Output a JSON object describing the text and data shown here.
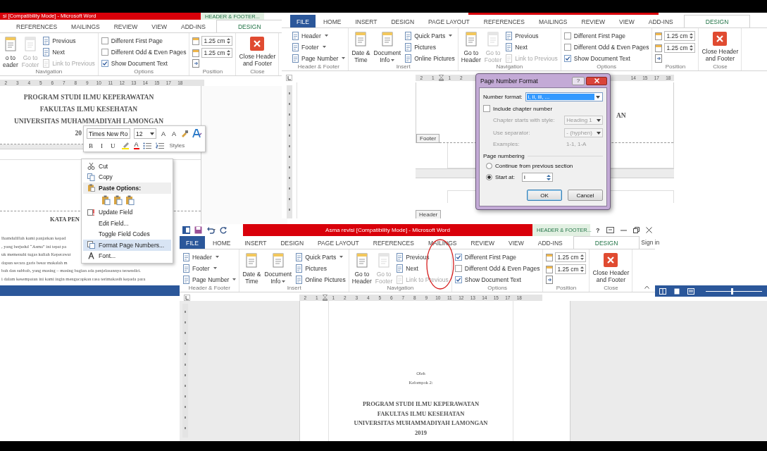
{
  "left_window": {
    "title": "si [Compatibility Mode] - Microsoft Word",
    "context_tab": "HEADER & FOOTER...",
    "tabs": [
      {
        "label": "REFERENCES",
        "kind": "normal",
        "selected": false
      },
      {
        "label": "MAILINGS",
        "kind": "normal",
        "selected": false
      },
      {
        "label": "REVIEW",
        "kind": "normal",
        "selected": false
      },
      {
        "label": "VIEW",
        "kind": "normal",
        "selected": false
      },
      {
        "label": "ADD-INS",
        "kind": "normal",
        "selected": false
      },
      {
        "label": "DESIGN",
        "kind": "contextual",
        "selected": true
      }
    ],
    "groups": [
      {
        "label": "Navigation",
        "items": [
          {
            "kind": "large",
            "label": "o to\neader",
            "disabled": false,
            "dropdown": false
          },
          {
            "kind": "large",
            "label": "Go to\nFooter",
            "disabled": true,
            "dropdown": false
          },
          {
            "kind": "small",
            "label": "Previous",
            "disabled": false,
            "dropdown": false
          },
          {
            "kind": "small",
            "label": "Next",
            "disabled": false,
            "dropdown": false
          },
          {
            "kind": "small",
            "label": "Link to Previous",
            "disabled": true,
            "dropdown": false
          }
        ]
      },
      {
        "label": "Options",
        "items": [
          {
            "kind": "check",
            "label": "Different First Page",
            "checked": false
          },
          {
            "kind": "check",
            "label": "Different Odd & Even Pages",
            "checked": false
          },
          {
            "kind": "check",
            "label": "Show Document Text",
            "checked": true
          }
        ]
      },
      {
        "label": "Position",
        "items": [
          {
            "kind": "spin",
            "value": "1.25 cm"
          },
          {
            "kind": "spin",
            "value": "1.25 cm"
          },
          {
            "kind": "icon"
          }
        ]
      },
      {
        "label": "Close",
        "items": [
          {
            "kind": "close",
            "label": "Close Header\nand Footer"
          }
        ]
      }
    ],
    "ruler": {
      "segments": [
        [
          "2",
          "3",
          "4",
          "5",
          "6",
          "7",
          "8",
          "9",
          "10",
          "11",
          "12",
          "13",
          "14",
          "15",
          "17",
          "18"
        ]
      ]
    },
    "document": {
      "title_lines": [
        "PROGRAM STUDI ILMU KEPERAWATAN",
        "FAKULTAS ILMU KESEHATAN",
        "UNIVERSITAS MUHAMMADIYAH LAMONGAN"
      ],
      "year": "20",
      "heading": "KATA PEN",
      "paragraph_lines": [
        "lhamdulillah kami panjatkan kepad",
        ", yang berjudul “Asma” ini tepat pa",
        "uk memenuhi tugas kuliah Keperawat",
        "dapun secara garis besar makalah m",
        "bah dan subbab, yang masing – masing bagian ada penjelasannya tersendiri.",
        "i dalam kesempatan ini kami ingin mengucapkan rasa terimakasih kepada para"
      ]
    }
  },
  "top_window": {
    "tabs": [
      {
        "label": "FILE",
        "kind": "file",
        "selected": false
      },
      {
        "label": "HOME",
        "kind": "normal",
        "selected": false
      },
      {
        "label": "INSERT",
        "kind": "normal",
        "selected": false
      },
      {
        "label": "DESIGN",
        "kind": "normal",
        "selected": false
      },
      {
        "label": "PAGE LAYOUT",
        "kind": "normal",
        "selected": false
      },
      {
        "label": "REFERENCES",
        "kind": "normal",
        "selected": false
      },
      {
        "label": "MAILINGS",
        "kind": "normal",
        "selected": false
      },
      {
        "label": "REVIEW",
        "kind": "normal",
        "selected": false
      },
      {
        "label": "VIEW",
        "kind": "normal",
        "selected": false
      },
      {
        "label": "ADD-INS",
        "kind": "normal",
        "selected": false
      },
      {
        "label": "DESIGN",
        "kind": "contextual",
        "selected": true
      }
    ],
    "groups": [
      {
        "label": "Header & Footer",
        "items": [
          {
            "kind": "small",
            "label": "Header",
            "disabled": false,
            "dropdown": true
          },
          {
            "kind": "small",
            "label": "Footer",
            "disabled": false,
            "dropdown": true
          },
          {
            "kind": "small",
            "label": "Page Number",
            "disabled": false,
            "dropdown": true
          }
        ]
      },
      {
        "label": "Insert",
        "items": [
          {
            "kind": "large",
            "label": "Date &\nTime",
            "disabled": false,
            "dropdown": false
          },
          {
            "kind": "large",
            "label": "Document\nInfo",
            "disabled": false,
            "dropdown": true
          },
          {
            "kind": "small",
            "label": "Quick Parts",
            "disabled": false,
            "dropdown": true
          },
          {
            "kind": "small",
            "label": "Pictures",
            "disabled": false,
            "dropdown": false
          },
          {
            "kind": "small",
            "label": "Online Pictures",
            "disabled": false,
            "dropdown": false
          }
        ]
      },
      {
        "label": "Navigation",
        "items": [
          {
            "kind": "large",
            "label": "Go to\nHeader",
            "disabled": false,
            "dropdown": false
          },
          {
            "kind": "large",
            "label": "Go to\nFooter",
            "disabled": true,
            "dropdown": false
          },
          {
            "kind": "small",
            "label": "Previous",
            "disabled": false,
            "dropdown": false
          },
          {
            "kind": "small",
            "label": "Next",
            "disabled": false,
            "dropdown": false
          },
          {
            "kind": "small",
            "label": "Link to Previous",
            "disabled": true,
            "dropdown": false
          }
        ]
      },
      {
        "label": "Options",
        "items": [
          {
            "kind": "check",
            "label": "Different First Page",
            "checked": false
          },
          {
            "kind": "check",
            "label": "Different Odd & Even Pages",
            "checked": false
          },
          {
            "kind": "check",
            "label": "Show Document Text",
            "checked": true
          }
        ]
      },
      {
        "label": "Position",
        "items": [
          {
            "kind": "spin",
            "value": "1.25 cm"
          },
          {
            "kind": "spin",
            "value": "1.25 cm"
          },
          {
            "kind": "icon"
          }
        ]
      },
      {
        "label": "Close",
        "items": [
          {
            "kind": "close",
            "label": "Close Header\nand Footer"
          }
        ]
      }
    ],
    "ruler": {
      "segments": [
        [
          "2",
          "1",
          "1",
          "2"
        ],
        [
          "14",
          "15",
          "17",
          "18"
        ]
      ],
      "indent_marker": true
    },
    "document": {
      "fragment": "AN",
      "footer_tag": "Footer",
      "header_tag": "Header"
    }
  },
  "bottom_window": {
    "title": "Asma revisi [Compatibility Mode] - Microsoft Word",
    "context_tab": "HEADER & FOOTER...",
    "help": "?",
    "sign_in": "Sign in",
    "tabs": [
      {
        "label": "FILE",
        "kind": "file",
        "selected": false
      },
      {
        "label": "HOME",
        "kind": "normal",
        "selected": false
      },
      {
        "label": "INSERT",
        "kind": "normal",
        "selected": false
      },
      {
        "label": "DESIGN",
        "kind": "normal",
        "selected": false
      },
      {
        "label": "PAGE LAYOUT",
        "kind": "normal",
        "selected": false
      },
      {
        "label": "REFERENCES",
        "kind": "normal",
        "selected": false
      },
      {
        "label": "MAILINGS",
        "kind": "normal",
        "selected": false
      },
      {
        "label": "REVIEW",
        "kind": "normal",
        "selected": false
      },
      {
        "label": "VIEW",
        "kind": "normal",
        "selected": false
      },
      {
        "label": "ADD-INS",
        "kind": "normal",
        "selected": false
      },
      {
        "label": "DESIGN",
        "kind": "contextual",
        "selected": true
      }
    ],
    "groups": [
      {
        "label": "Header & Footer",
        "items": [
          {
            "kind": "small",
            "label": "Header",
            "disabled": false,
            "dropdown": true
          },
          {
            "kind": "small",
            "label": "Footer",
            "disabled": false,
            "dropdown": true
          },
          {
            "kind": "small",
            "label": "Page Number",
            "disabled": false,
            "dropdown": true
          }
        ]
      },
      {
        "label": "Insert",
        "items": [
          {
            "kind": "large",
            "label": "Date &\nTime",
            "disabled": false,
            "dropdown": false
          },
          {
            "kind": "large",
            "label": "Document\nInfo",
            "disabled": false,
            "dropdown": true
          },
          {
            "kind": "small",
            "label": "Quick Parts",
            "disabled": false,
            "dropdown": true
          },
          {
            "kind": "small",
            "label": "Pictures",
            "disabled": false,
            "dropdown": false
          },
          {
            "kind": "small",
            "label": "Online Pictures",
            "disabled": false,
            "dropdown": false
          }
        ]
      },
      {
        "label": "Navigation",
        "items": [
          {
            "kind": "large",
            "label": "Go to\nHeader",
            "disabled": false,
            "dropdown": false
          },
          {
            "kind": "large",
            "label": "Go to\nFooter",
            "disabled": true,
            "dropdown": false
          },
          {
            "kind": "small",
            "label": "Previous",
            "disabled": false,
            "dropdown": false
          },
          {
            "kind": "small",
            "label": "Next",
            "disabled": false,
            "dropdown": false
          },
          {
            "kind": "small",
            "label": "Link to Previous",
            "disabled": true,
            "dropdown": false
          }
        ]
      },
      {
        "label": "Options",
        "items": [
          {
            "kind": "check",
            "label": "Different First Page",
            "checked": true
          },
          {
            "kind": "check",
            "label": "Different Odd & Even Pages",
            "checked": false
          },
          {
            "kind": "check",
            "label": "Show Document Text",
            "checked": true
          }
        ]
      },
      {
        "label": "Position",
        "items": [
          {
            "kind": "spin",
            "value": "1.25 cm"
          },
          {
            "kind": "spin",
            "value": "1.25 cm"
          },
          {
            "kind": "icon"
          }
        ]
      },
      {
        "label": "Close",
        "items": [
          {
            "kind": "close",
            "label": "Close Header\nand Footer"
          }
        ]
      }
    ],
    "ruler": {
      "segments": [
        [
          "2",
          "1",
          "1",
          "2",
          "3",
          "4",
          "5",
          "6",
          "7",
          "8",
          "9",
          "10",
          "11",
          "12",
          "13",
          "14",
          "15",
          "17",
          "18"
        ]
      ],
      "indent_marker": true
    },
    "status_bar": {
      "zoom_slider": {
        "level": 0.45
      }
    },
    "document": {
      "lines": [
        {
          "text": "Oleh",
          "kind": "small"
        },
        {
          "text": "Kelompok 2:",
          "kind": "small"
        },
        {
          "text": "PROGRAM STUDI ILMU KEPERAWATAN",
          "kind": "heading"
        },
        {
          "text": "FAKULTAS ILMU KESEHATAN",
          "kind": "heading"
        },
        {
          "text": "UNIVERSITAS MUHAMMADIYAH LAMONGAN",
          "kind": "heading"
        },
        {
          "text": "2019",
          "kind": "heading"
        }
      ]
    }
  },
  "mini_toolbar": {
    "font": "Times New Ro",
    "size": "12",
    "grow": "A",
    "shrink": "A",
    "format_buttons": [
      "B",
      "I",
      "U"
    ],
    "font_color": "A",
    "styles": "Styles"
  },
  "context_menu": {
    "items": [
      {
        "kind": "item",
        "label": "Cut",
        "selected": false
      },
      {
        "kind": "item",
        "label": "Copy",
        "selected": false
      },
      {
        "kind": "header",
        "label": "Paste Options:",
        "selected": false
      },
      {
        "kind": "paste_icons",
        "selected": false
      },
      {
        "kind": "item",
        "label": "Update Field",
        "selected": false
      },
      {
        "kind": "item",
        "label": "Edit Field...",
        "selected": false
      },
      {
        "kind": "item",
        "label": "Toggle Field Codes",
        "selected": false
      },
      {
        "kind": "item",
        "label": "Format Page Numbers...",
        "selected": true
      },
      {
        "kind": "item",
        "label": "Font...",
        "selected": false
      }
    ]
  },
  "page_number_dialog": {
    "title": "Page Number Format",
    "help": "?",
    "number_format_label": "Number format:",
    "number_format": "i, ii, iii, ...",
    "include_chapter": {
      "label": "Include chapter number",
      "checked": false
    },
    "chapter_style": {
      "label": "Chapter starts with style:",
      "value": "Heading 1",
      "disabled": true
    },
    "separator": {
      "label": "Use separator:",
      "value": "-  (hyphen)",
      "disabled": true
    },
    "examples": {
      "label": "Examples:",
      "value": "1-1, 1-A",
      "disabled": true
    },
    "section": "Page numbering",
    "radios": [
      {
        "label": "Continue from previous section",
        "selected": false
      },
      {
        "label": "Start at:",
        "selected": true
      }
    ],
    "start_at": "i",
    "buttons": [
      {
        "label": "OK",
        "default": true
      },
      {
        "label": "Cancel",
        "default": false
      }
    ]
  }
}
